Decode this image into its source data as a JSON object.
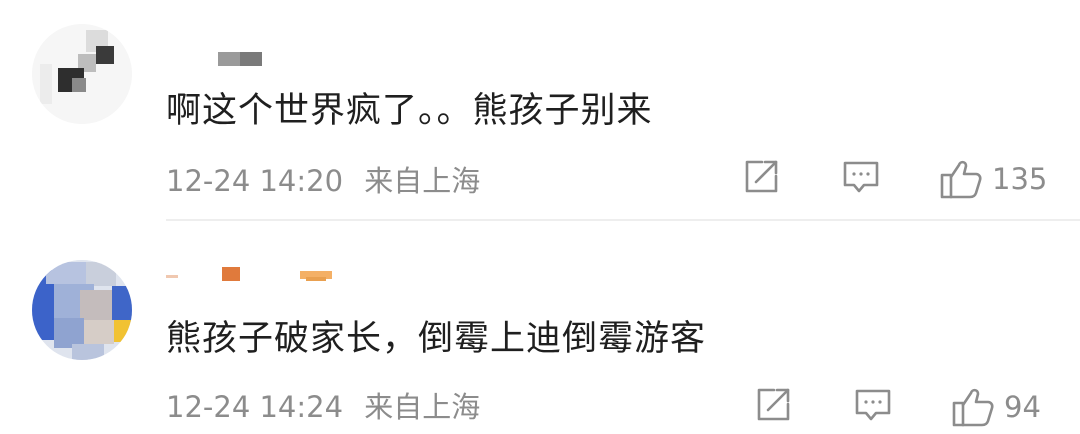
{
  "comments": [
    {
      "text": "啊这个世界疯了。。熊孩子别来",
      "time": "12-24 14:20",
      "location": "来自上海",
      "likes": "135",
      "icons": {
        "share": "share-icon",
        "reply": "comment-icon",
        "like": "thumbs-up-icon"
      }
    },
    {
      "text": "熊孩子破家长，倒霉上迪倒霉游客",
      "time": "12-24 14:24",
      "location": "来自上海",
      "likes": "94",
      "icons": {
        "share": "share-icon",
        "reply": "comment-icon",
        "like": "thumbs-up-icon"
      }
    }
  ],
  "colors": {
    "text": "#1f1f1f",
    "meta": "#8c8c8c",
    "divider": "#eeeeee"
  }
}
